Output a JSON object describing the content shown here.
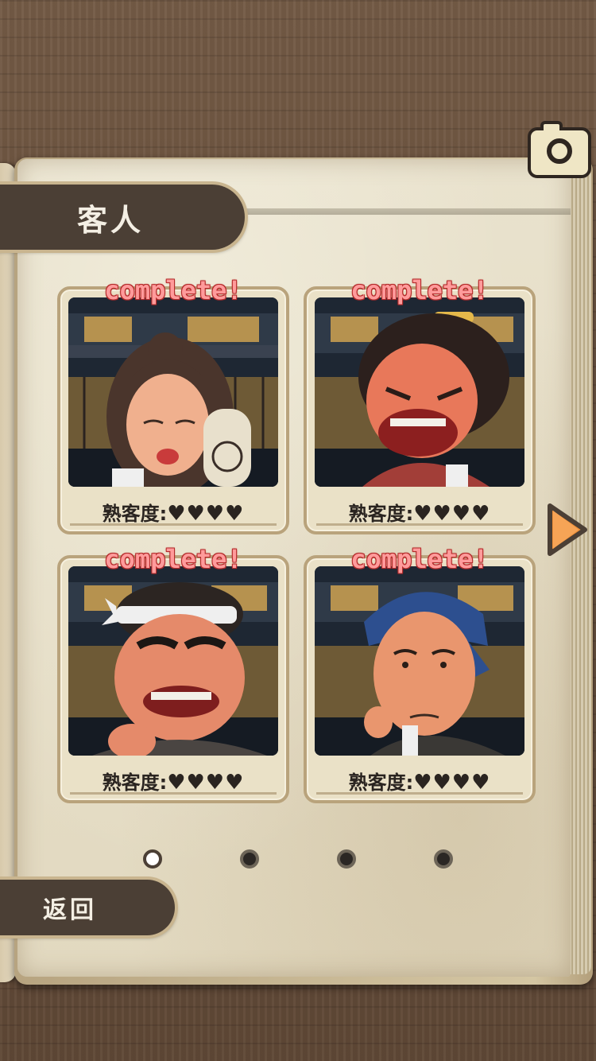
{
  "header": {
    "title": "客人"
  },
  "toolbar": {
    "camera_icon": "camera-icon"
  },
  "colors": {
    "accent": "#4b3f35",
    "complete_text": "#ff9b9b",
    "arrow": "#f0913a"
  },
  "cards": [
    {
      "status": "complete!",
      "familiarity_label": "熟客度:",
      "hearts": "♥♥♥♥",
      "character": "woman-with-sake-bottle"
    },
    {
      "status": "complete!",
      "familiarity_label": "熟客度:",
      "hearts": "♥♥♥♥",
      "character": "angry-samurai"
    },
    {
      "status": "complete!",
      "familiarity_label": "熟客度:",
      "hearts": "♥♥♥♥",
      "character": "headband-worker"
    },
    {
      "status": "complete!",
      "familiarity_label": "熟客度:",
      "hearts": "♥♥♥♥",
      "character": "tired-man-bandana"
    }
  ],
  "pagination": {
    "current_page": 1,
    "total_pages": 4
  },
  "footer": {
    "back_label": "返回"
  }
}
